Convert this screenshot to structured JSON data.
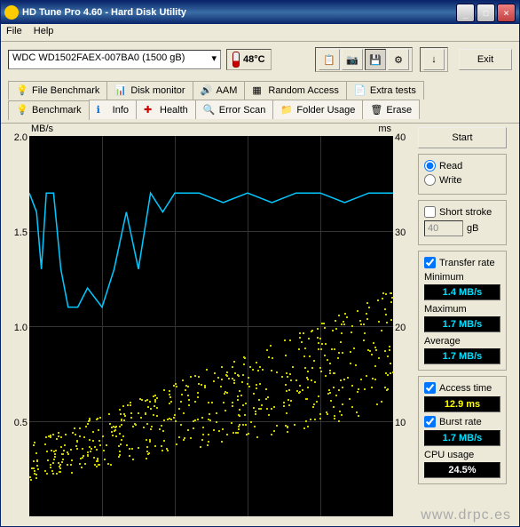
{
  "title": "HD Tune Pro 4.60 - Hard Disk Utility",
  "menu": {
    "file": "File",
    "help": "Help"
  },
  "drive": "WDC WD1502FAEX-007BA0 (1500 gB)",
  "temperature": "48°C",
  "exit": "Exit",
  "tabs_row1": [
    {
      "label": "File Benchmark"
    },
    {
      "label": "Disk monitor"
    },
    {
      "label": "AAM"
    },
    {
      "label": "Random Access"
    },
    {
      "label": "Extra tests"
    }
  ],
  "tabs_row2": [
    {
      "label": "Benchmark",
      "active": true
    },
    {
      "label": "Info"
    },
    {
      "label": "Health"
    },
    {
      "label": "Error Scan"
    },
    {
      "label": "Folder Usage"
    },
    {
      "label": "Erase"
    }
  ],
  "chart": {
    "y_left_label": "MB/s",
    "y_right_label": "ms",
    "y_left_ticks": [
      "2.0",
      "1.5",
      "1.0",
      "0.5"
    ],
    "y_right_ticks": [
      "40",
      "30",
      "20",
      "10"
    ]
  },
  "sidebar": {
    "start": "Start",
    "read": "Read",
    "write": "Write",
    "short_stroke": "Short stroke",
    "ss_value": "40",
    "ss_unit": "gB",
    "transfer_rate": "Transfer rate",
    "minimum": "Minimum",
    "min_val": "1.4 MB/s",
    "maximum": "Maximum",
    "max_val": "1.7 MB/s",
    "average": "Average",
    "avg_val": "1.7 MB/s",
    "access_time": "Access time",
    "access_val": "12.9 ms",
    "burst_rate": "Burst rate",
    "burst_val": "1.7 MB/s",
    "cpu_usage": "CPU usage",
    "cpu_val": "24.5%"
  },
  "watermark": "www.drpc.es",
  "chart_data": {
    "type": "line+scatter",
    "title": "",
    "xlabel": "gB",
    "x_range": [
      0,
      1500
    ],
    "y_left_label": "MB/s",
    "y_left_range": [
      0,
      2.0
    ],
    "y_right_label": "ms",
    "y_right_range": [
      0,
      40
    ],
    "series": [
      {
        "name": "Transfer rate (MB/s)",
        "axis": "left",
        "type": "line",
        "color": "#00c8ff",
        "x": [
          0,
          30,
          50,
          70,
          100,
          130,
          160,
          200,
          240,
          300,
          350,
          400,
          450,
          500,
          550,
          600,
          700,
          800,
          900,
          1000,
          1100,
          1200,
          1300,
          1400,
          1500
        ],
        "values": [
          1.7,
          1.6,
          1.3,
          1.7,
          1.7,
          1.3,
          1.1,
          1.1,
          1.2,
          1.1,
          1.3,
          1.6,
          1.3,
          1.7,
          1.6,
          1.7,
          1.7,
          1.65,
          1.7,
          1.65,
          1.7,
          1.7,
          1.65,
          1.7,
          1.7
        ]
      },
      {
        "name": "Access time (ms)",
        "axis": "right",
        "type": "scatter",
        "color": "#cccc00",
        "note": "~550 random points, spread increases toward right; lower band ~4–12 ms, upper cluster ~10–22 ms"
      }
    ]
  }
}
